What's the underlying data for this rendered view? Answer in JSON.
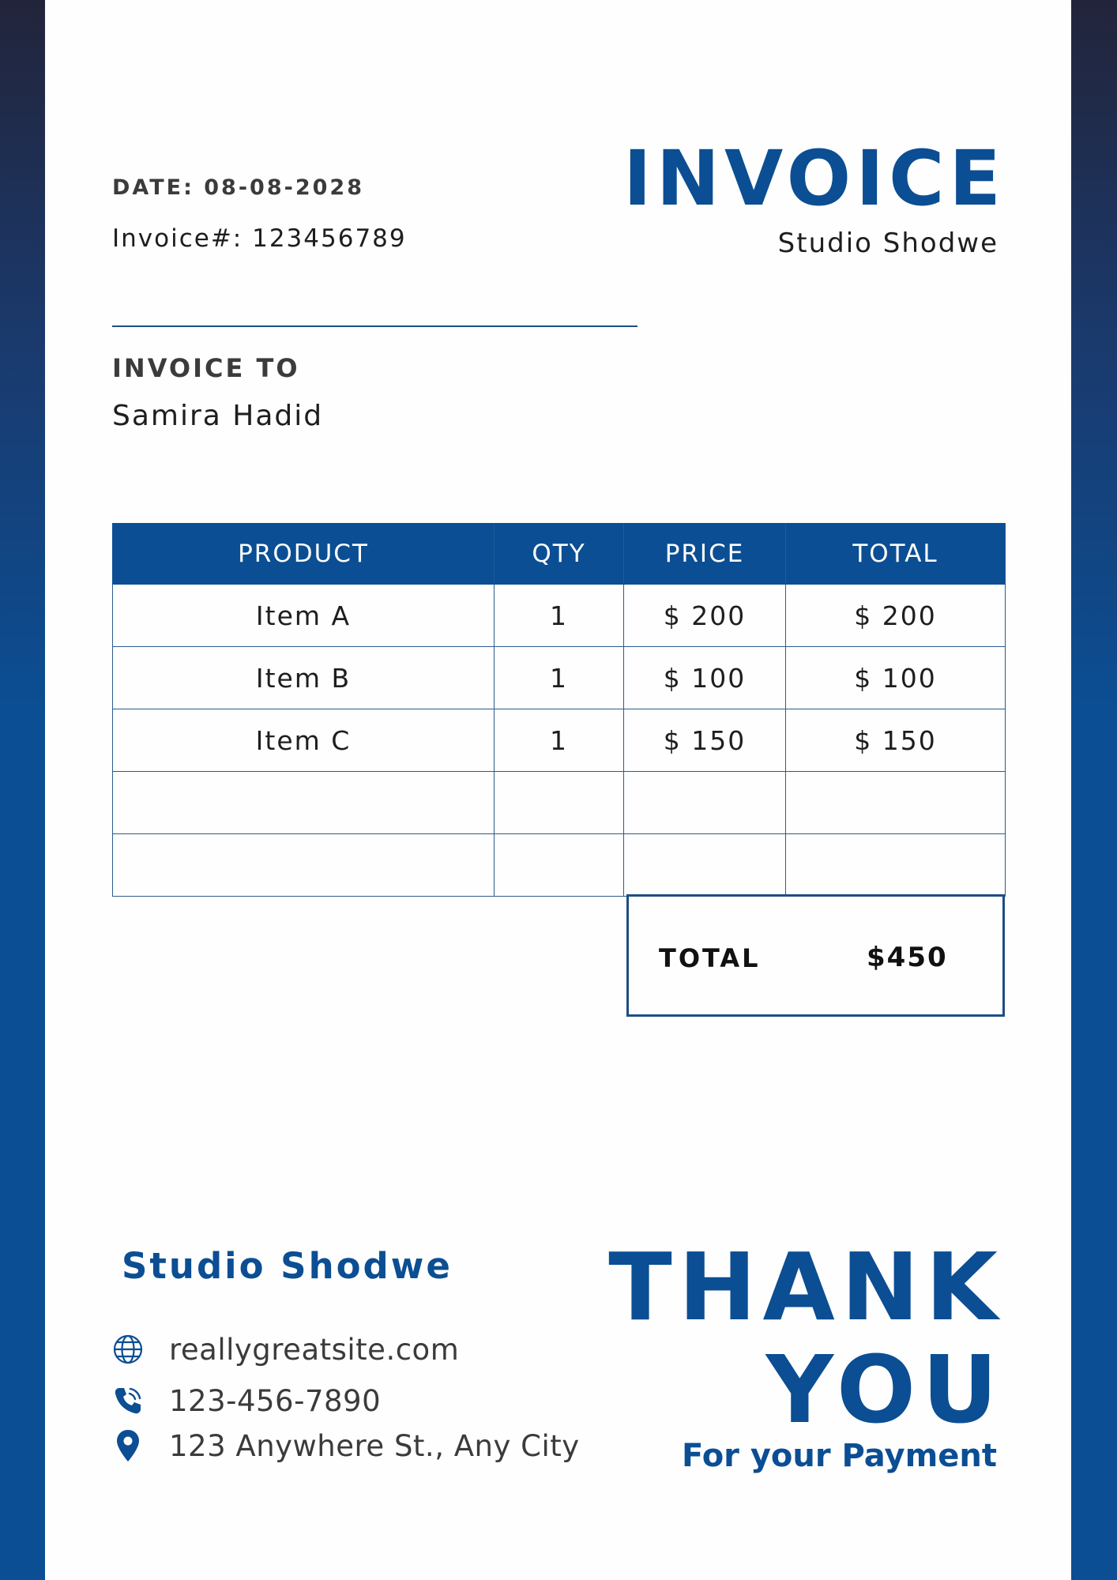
{
  "header": {
    "date": "DATE: 08-08-2028",
    "invoice_number": "Invoice#: 123456789",
    "title": "INVOICE",
    "company": "Studio Shodwe"
  },
  "bill_to": {
    "label": "INVOICE TO",
    "name": "Samira Hadid"
  },
  "table": {
    "columns": [
      "PRODUCT",
      "QTY",
      "PRICE",
      "TOTAL"
    ],
    "rows": [
      [
        "Item A",
        "1",
        "$ 200",
        "$ 200"
      ],
      [
        "Item B",
        "1",
        "$ 100",
        "$ 100"
      ],
      [
        "Item C",
        "1",
        "$ 150",
        "$ 150"
      ],
      [
        "",
        "",
        "",
        ""
      ],
      [
        "",
        "",
        "",
        ""
      ]
    ]
  },
  "summary": {
    "total_label": "TOTAL",
    "total_value": "$450"
  },
  "footer": {
    "company": "Studio Shodwe",
    "website": "reallygreatsite.com",
    "phone": "123-456-7890",
    "address": "123 Anywhere St., Any City",
    "thank": "THANK",
    "you": "YOU",
    "for_payment": "For your Payment"
  },
  "icons": {
    "website": "globe-icon",
    "phone": "phone-icon",
    "address": "map-pin-icon"
  },
  "colors": {
    "brand": "#0b4e93",
    "border": "#1d4e86"
  }
}
